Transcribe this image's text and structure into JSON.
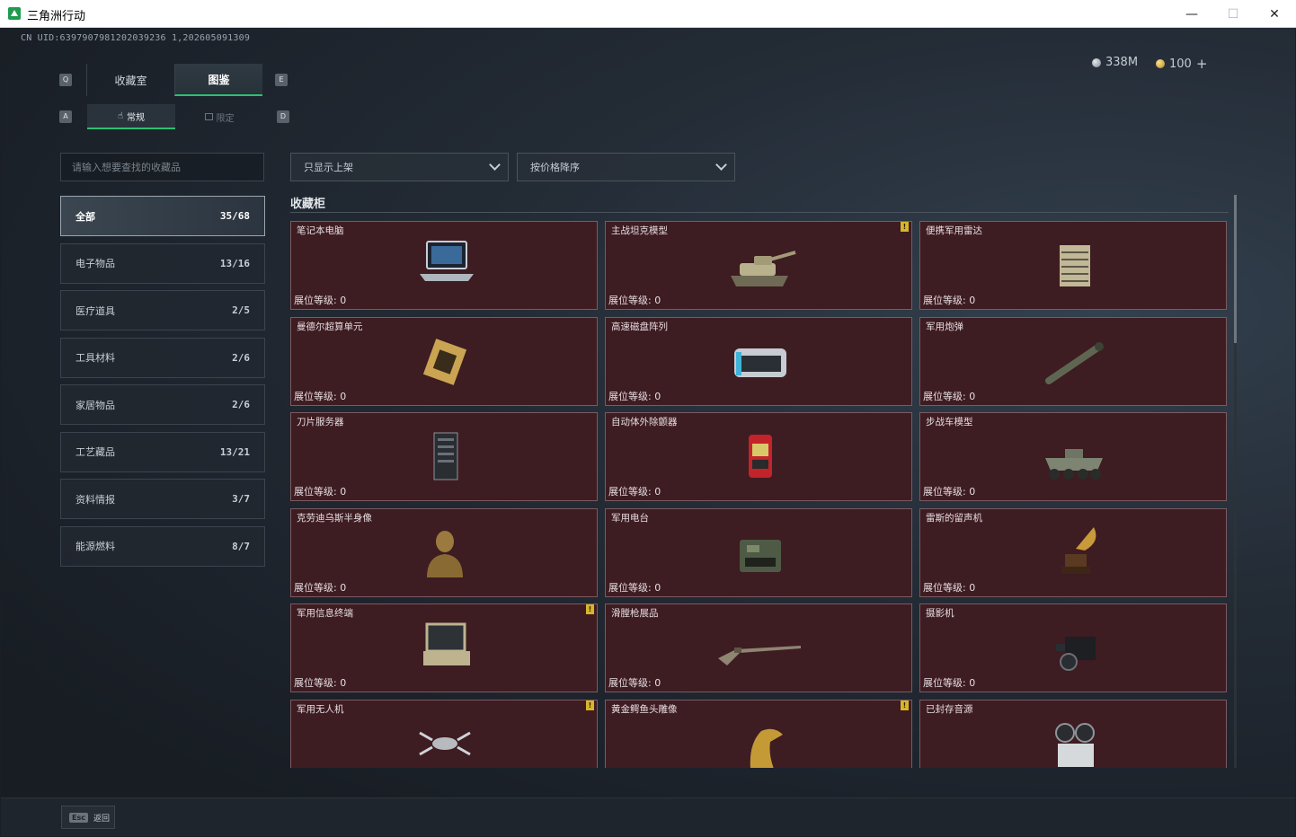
{
  "window": {
    "title": "三角洲行动",
    "minimize": "—",
    "maximize": "☐",
    "close": "✕"
  },
  "header": {
    "uid": "CN UID:6397907981202039236 1,202605091309",
    "currency_silver": "338M",
    "currency_gold": "100",
    "add_label": "+"
  },
  "keyhints": {
    "tab_left": "Q",
    "tab_right": "E",
    "sub_left": "A",
    "sub_right": "D"
  },
  "tabs": [
    {
      "label": "收藏室"
    },
    {
      "label": "图鉴"
    }
  ],
  "subtabs": [
    {
      "label": "常规"
    },
    {
      "label": "限定"
    }
  ],
  "search": {
    "placeholder": "请输入想要查找的收藏品"
  },
  "categories": [
    {
      "label": "全部",
      "count": "35/68"
    },
    {
      "label": "电子物品",
      "count": "13/16"
    },
    {
      "label": "医疗道具",
      "count": "2/5"
    },
    {
      "label": "工具材料",
      "count": "2/6"
    },
    {
      "label": "家居物品",
      "count": "2/6"
    },
    {
      "label": "工艺藏品",
      "count": "13/21"
    },
    {
      "label": "资料情报",
      "count": "3/7"
    },
    {
      "label": "能源燃料",
      "count": "8/7"
    }
  ],
  "filters": {
    "show_filter": "只显示上架",
    "sort": "按价格降序"
  },
  "section": {
    "title": "收藏柜"
  },
  "items": [
    {
      "name": "笔记本电脑",
      "level": "展位等级: 0",
      "badge": "",
      "icon": "laptop-icon"
    },
    {
      "name": "主战坦克模型",
      "level": "展位等级: 0",
      "badge": "!",
      "icon": "tank-icon"
    },
    {
      "name": "便携军用雷达",
      "level": "展位等级: 0",
      "badge": "",
      "icon": "radar-icon"
    },
    {
      "name": "曼德尔超算单元",
      "level": "展位等级: 0",
      "badge": "",
      "icon": "chip-icon"
    },
    {
      "name": "高速磁盘阵列",
      "level": "展位等级: 0",
      "badge": "",
      "icon": "disk-array-icon"
    },
    {
      "name": "军用炮弹",
      "level": "展位等级: 0",
      "badge": "",
      "icon": "shell-icon"
    },
    {
      "name": "刀片服务器",
      "level": "展位等级: 0",
      "badge": "",
      "icon": "server-icon"
    },
    {
      "name": "自动体外除颤器",
      "level": "展位等级: 0",
      "badge": "",
      "icon": "defibrillator-icon"
    },
    {
      "name": "步战车模型",
      "level": "展位等级: 0",
      "badge": "",
      "icon": "ifv-icon"
    },
    {
      "name": "克劳迪乌斯半身像",
      "level": "展位等级: 0",
      "badge": "",
      "icon": "bust-icon"
    },
    {
      "name": "军用电台",
      "level": "展位等级: 0",
      "badge": "",
      "icon": "radio-icon"
    },
    {
      "name": "雷斯的留声机",
      "level": "展位等级: 0",
      "badge": "",
      "icon": "gramophone-icon"
    },
    {
      "name": "军用信息终端",
      "level": "展位等级: 0",
      "badge": "!",
      "icon": "terminal-icon"
    },
    {
      "name": "滑膛枪展品",
      "level": "展位等级: 0",
      "badge": "",
      "icon": "musket-icon"
    },
    {
      "name": "摄影机",
      "level": "展位等级: 0",
      "badge": "",
      "icon": "camera-icon"
    },
    {
      "name": "军用无人机",
      "level": "",
      "badge": "!",
      "icon": "drone-icon"
    },
    {
      "name": "黄金鳄鱼头雕像",
      "level": "",
      "badge": "!",
      "icon": "crocodile-statue-icon"
    },
    {
      "name": "已封存音源",
      "level": "",
      "badge": "",
      "icon": "reel-recorder-icon"
    }
  ],
  "footer": {
    "esc_key": "Esc",
    "esc_label": "返回"
  }
}
